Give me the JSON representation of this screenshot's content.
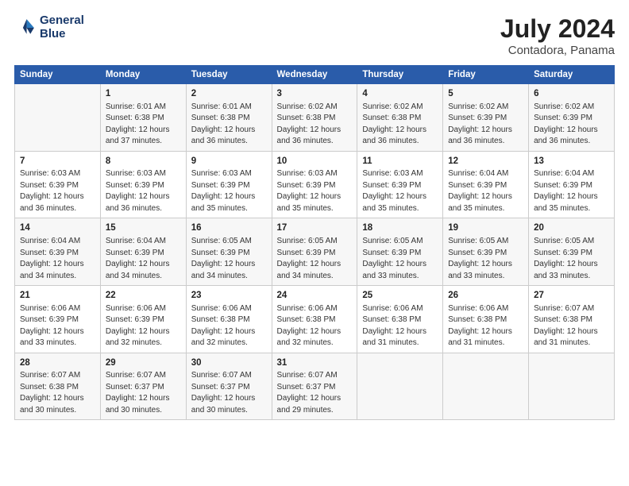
{
  "logo": {
    "line1": "General",
    "line2": "Blue"
  },
  "title": "July 2024",
  "subtitle": "Contadora, Panama",
  "days_header": [
    "Sunday",
    "Monday",
    "Tuesday",
    "Wednesday",
    "Thursday",
    "Friday",
    "Saturday"
  ],
  "weeks": [
    [
      {
        "num": "",
        "lines": []
      },
      {
        "num": "1",
        "lines": [
          "Sunrise: 6:01 AM",
          "Sunset: 6:38 PM",
          "Daylight: 12 hours",
          "and 37 minutes."
        ]
      },
      {
        "num": "2",
        "lines": [
          "Sunrise: 6:01 AM",
          "Sunset: 6:38 PM",
          "Daylight: 12 hours",
          "and 36 minutes."
        ]
      },
      {
        "num": "3",
        "lines": [
          "Sunrise: 6:02 AM",
          "Sunset: 6:38 PM",
          "Daylight: 12 hours",
          "and 36 minutes."
        ]
      },
      {
        "num": "4",
        "lines": [
          "Sunrise: 6:02 AM",
          "Sunset: 6:38 PM",
          "Daylight: 12 hours",
          "and 36 minutes."
        ]
      },
      {
        "num": "5",
        "lines": [
          "Sunrise: 6:02 AM",
          "Sunset: 6:39 PM",
          "Daylight: 12 hours",
          "and 36 minutes."
        ]
      },
      {
        "num": "6",
        "lines": [
          "Sunrise: 6:02 AM",
          "Sunset: 6:39 PM",
          "Daylight: 12 hours",
          "and 36 minutes."
        ]
      }
    ],
    [
      {
        "num": "7",
        "lines": [
          "Sunrise: 6:03 AM",
          "Sunset: 6:39 PM",
          "Daylight: 12 hours",
          "and 36 minutes."
        ]
      },
      {
        "num": "8",
        "lines": [
          "Sunrise: 6:03 AM",
          "Sunset: 6:39 PM",
          "Daylight: 12 hours",
          "and 36 minutes."
        ]
      },
      {
        "num": "9",
        "lines": [
          "Sunrise: 6:03 AM",
          "Sunset: 6:39 PM",
          "Daylight: 12 hours",
          "and 35 minutes."
        ]
      },
      {
        "num": "10",
        "lines": [
          "Sunrise: 6:03 AM",
          "Sunset: 6:39 PM",
          "Daylight: 12 hours",
          "and 35 minutes."
        ]
      },
      {
        "num": "11",
        "lines": [
          "Sunrise: 6:03 AM",
          "Sunset: 6:39 PM",
          "Daylight: 12 hours",
          "and 35 minutes."
        ]
      },
      {
        "num": "12",
        "lines": [
          "Sunrise: 6:04 AM",
          "Sunset: 6:39 PM",
          "Daylight: 12 hours",
          "and 35 minutes."
        ]
      },
      {
        "num": "13",
        "lines": [
          "Sunrise: 6:04 AM",
          "Sunset: 6:39 PM",
          "Daylight: 12 hours",
          "and 35 minutes."
        ]
      }
    ],
    [
      {
        "num": "14",
        "lines": [
          "Sunrise: 6:04 AM",
          "Sunset: 6:39 PM",
          "Daylight: 12 hours",
          "and 34 minutes."
        ]
      },
      {
        "num": "15",
        "lines": [
          "Sunrise: 6:04 AM",
          "Sunset: 6:39 PM",
          "Daylight: 12 hours",
          "and 34 minutes."
        ]
      },
      {
        "num": "16",
        "lines": [
          "Sunrise: 6:05 AM",
          "Sunset: 6:39 PM",
          "Daylight: 12 hours",
          "and 34 minutes."
        ]
      },
      {
        "num": "17",
        "lines": [
          "Sunrise: 6:05 AM",
          "Sunset: 6:39 PM",
          "Daylight: 12 hours",
          "and 34 minutes."
        ]
      },
      {
        "num": "18",
        "lines": [
          "Sunrise: 6:05 AM",
          "Sunset: 6:39 PM",
          "Daylight: 12 hours",
          "and 33 minutes."
        ]
      },
      {
        "num": "19",
        "lines": [
          "Sunrise: 6:05 AM",
          "Sunset: 6:39 PM",
          "Daylight: 12 hours",
          "and 33 minutes."
        ]
      },
      {
        "num": "20",
        "lines": [
          "Sunrise: 6:05 AM",
          "Sunset: 6:39 PM",
          "Daylight: 12 hours",
          "and 33 minutes."
        ]
      }
    ],
    [
      {
        "num": "21",
        "lines": [
          "Sunrise: 6:06 AM",
          "Sunset: 6:39 PM",
          "Daylight: 12 hours",
          "and 33 minutes."
        ]
      },
      {
        "num": "22",
        "lines": [
          "Sunrise: 6:06 AM",
          "Sunset: 6:39 PM",
          "Daylight: 12 hours",
          "and 32 minutes."
        ]
      },
      {
        "num": "23",
        "lines": [
          "Sunrise: 6:06 AM",
          "Sunset: 6:38 PM",
          "Daylight: 12 hours",
          "and 32 minutes."
        ]
      },
      {
        "num": "24",
        "lines": [
          "Sunrise: 6:06 AM",
          "Sunset: 6:38 PM",
          "Daylight: 12 hours",
          "and 32 minutes."
        ]
      },
      {
        "num": "25",
        "lines": [
          "Sunrise: 6:06 AM",
          "Sunset: 6:38 PM",
          "Daylight: 12 hours",
          "and 31 minutes."
        ]
      },
      {
        "num": "26",
        "lines": [
          "Sunrise: 6:06 AM",
          "Sunset: 6:38 PM",
          "Daylight: 12 hours",
          "and 31 minutes."
        ]
      },
      {
        "num": "27",
        "lines": [
          "Sunrise: 6:07 AM",
          "Sunset: 6:38 PM",
          "Daylight: 12 hours",
          "and 31 minutes."
        ]
      }
    ],
    [
      {
        "num": "28",
        "lines": [
          "Sunrise: 6:07 AM",
          "Sunset: 6:38 PM",
          "Daylight: 12 hours",
          "and 30 minutes."
        ]
      },
      {
        "num": "29",
        "lines": [
          "Sunrise: 6:07 AM",
          "Sunset: 6:37 PM",
          "Daylight: 12 hours",
          "and 30 minutes."
        ]
      },
      {
        "num": "30",
        "lines": [
          "Sunrise: 6:07 AM",
          "Sunset: 6:37 PM",
          "Daylight: 12 hours",
          "and 30 minutes."
        ]
      },
      {
        "num": "31",
        "lines": [
          "Sunrise: 6:07 AM",
          "Sunset: 6:37 PM",
          "Daylight: 12 hours",
          "and 29 minutes."
        ]
      },
      {
        "num": "",
        "lines": []
      },
      {
        "num": "",
        "lines": []
      },
      {
        "num": "",
        "lines": []
      }
    ]
  ]
}
